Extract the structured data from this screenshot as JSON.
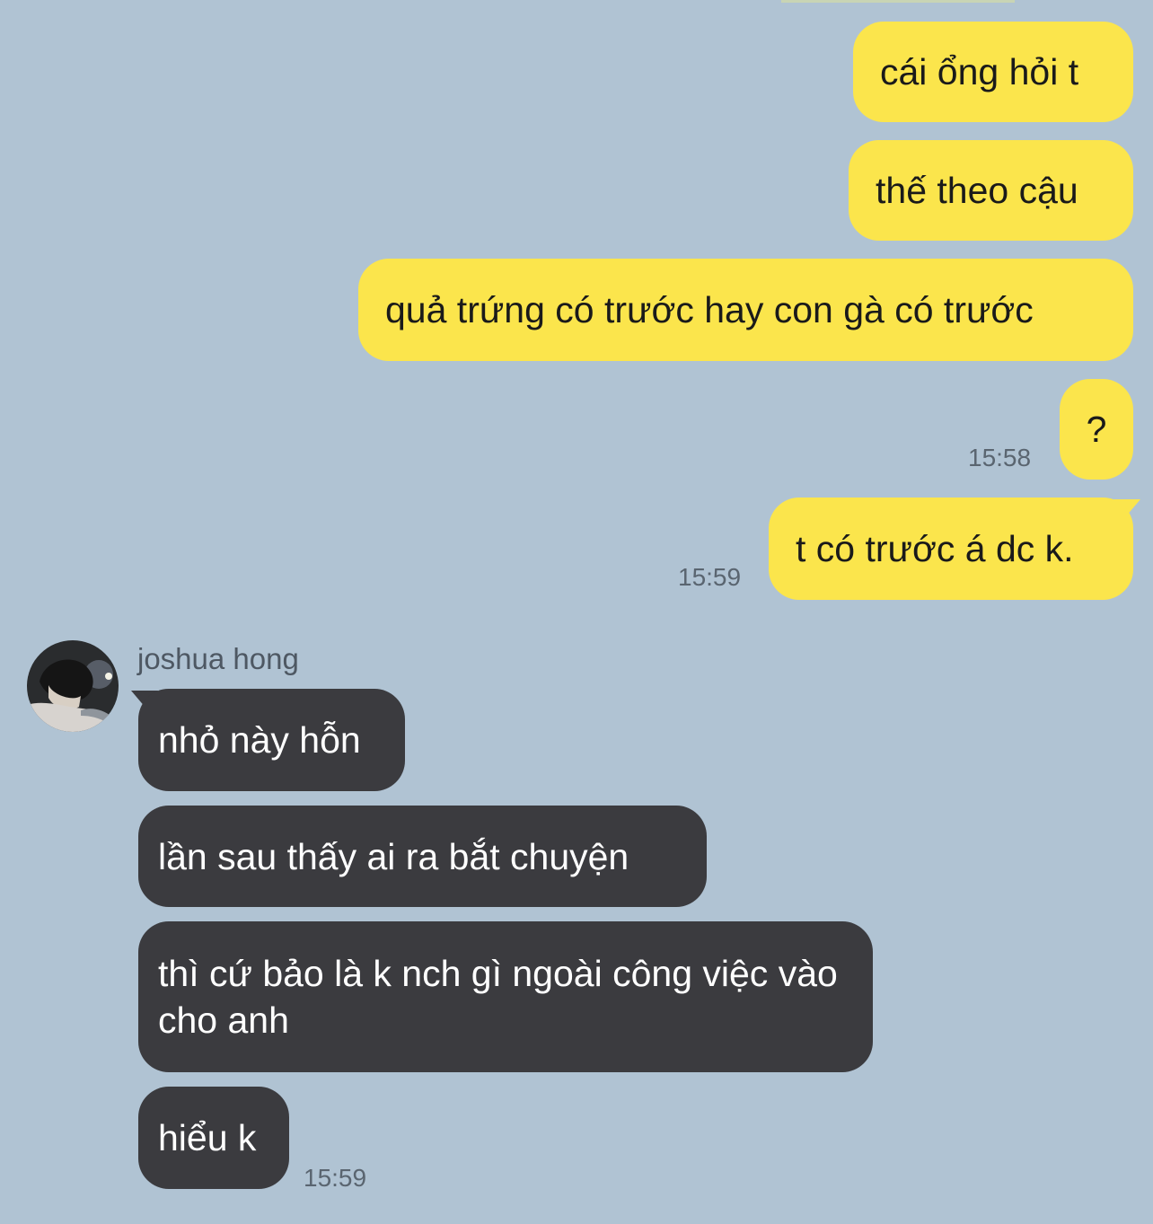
{
  "conversation": {
    "sent": [
      {
        "text": "cái ổng hỏi t"
      },
      {
        "text": "thế theo cậu"
      },
      {
        "text": "quả trứng có trước hay con gà có trước"
      },
      {
        "text": "?",
        "time": "15:58"
      },
      {
        "text": "t có trước á dc k.",
        "time": "15:59"
      }
    ],
    "contact": {
      "name": "joshua hong",
      "avatar_icon": "profile-photo"
    },
    "received": [
      {
        "text": "nhỏ này hỗn"
      },
      {
        "text": "lần sau thấy ai ra bắt chuyện"
      },
      {
        "text": "thì cứ bảo là k nch gì ngoài công việc vào cho anh"
      },
      {
        "text": "hiểu k",
        "time": "15:59"
      }
    ]
  },
  "colors": {
    "background": "#b0c3d3",
    "sent_bubble": "#fbe54c",
    "received_bubble": "#3b3b3f",
    "timestamp": "#5a6570"
  }
}
